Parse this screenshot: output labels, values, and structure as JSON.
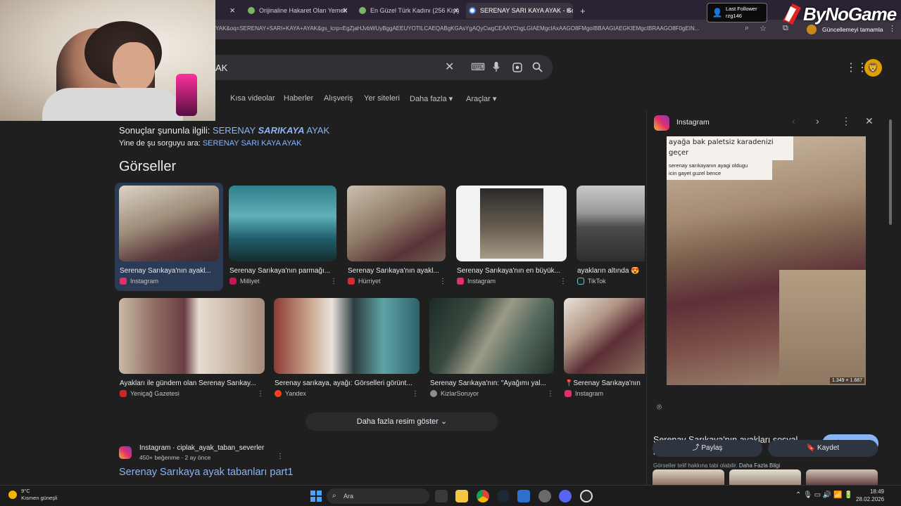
{
  "browser": {
    "tabs": [
      {
        "label": "Orijinaline Hakaret Olan Yemek",
        "color": "#7bb661"
      },
      {
        "label": "En Güzel Türk Kadını (256 Kişi)",
        "color": "#7bb661"
      },
      {
        "label": "SERENAY SARI KAYA AYAK - Go",
        "color": "#4285f4",
        "active": true
      }
    ],
    "new_tab": "+",
    "url": "YAK&oq=SERENAY+SARI+KAYA+AYAK&gs_lcrp=EgZjaHJvbWUyBggAEEUYOTILCAEQABgKGAsYgAQyCwgCEAAYChgLGIAEMgcIAxAAGO8FMgoIBBAAGIAEGKIEMgcIBRAAGO8F0gEIN...",
    "update_label": "Güncellemeyi tamamla"
  },
  "overlay": {
    "follower_title": "Last Follower",
    "follower_name": "rzg146",
    "brand": "ByNoGame"
  },
  "google": {
    "query": "AK",
    "nav": [
      "r",
      "Kısa videolar",
      "Haberler",
      "Alışveriş",
      "Yer siteleri",
      "Daha fazla ▾",
      "Araçlar ▾"
    ],
    "results_prefix": "Sonuçlar şununla ilgili: ",
    "results_term_a": "SERENAY ",
    "results_term_b": "SARIKAYA",
    "results_term_c": " AYAK",
    "search_instead_prefix": "Yine de şu sorguyu ara: ",
    "search_instead_term": "SERENAY SARI KAYA AYAK",
    "images_heading": "Görseller",
    "images_row1": [
      {
        "caption": "Serenay Sarıkaya'nın ayakl...",
        "source": "Instagram",
        "fav": "#e1306c"
      },
      {
        "caption": "Serenay Sarıkaya'nın parmağı...",
        "source": "Milliyet",
        "fav": "#c2185b"
      },
      {
        "caption": "Serenay Sarıkaya'nın ayakl...",
        "source": "Hürriyet",
        "fav": "#d32f2f"
      },
      {
        "caption": "Serenay Sarıkaya'nın en büyük...",
        "source": "Instagram",
        "fav": "#e1306c"
      },
      {
        "caption": "ayakların altında 😍",
        "source": "TikTok",
        "fav": "#222222"
      }
    ],
    "images_row2": [
      {
        "caption": "Ayakları ile gündem olan Serenay Sarıkay...",
        "source": "Yeniçağ Gazetesi",
        "fav": "#c62828"
      },
      {
        "caption": "Serenay sarıkaya, ayağı: Görselleri görünt...",
        "source": "Yandex",
        "fav": "#fc3f1d"
      },
      {
        "caption": "Serenay Sarıkaya'nın: \"Ayağımı yal...",
        "source": "KizlarSoruyor",
        "fav": "#8e8e8e"
      },
      {
        "caption": "📍Serenay Sarıkaya'nın",
        "source": "Instagram",
        "fav": "#e1306c"
      }
    ],
    "more_images": "Daha fazla resim göster",
    "result": {
      "site": "Instagram · ciplak_ayak_taban_severler",
      "meta": "450+ beğenme · 2 ay önce",
      "title": "Serenay Sarıkaya ayak tabanları part1"
    }
  },
  "panel": {
    "source": "Instagram",
    "meme_line1": "ayağa bak      paletsiz karadenizi",
    "meme_line2": "geçer",
    "meme_line3": "serenay sarıkayanın ayagi oldugu",
    "meme_line4": "icin gayet guzel bence",
    "dimensions": "1.349 × 1.687",
    "title": "Serenay Sarıkaya'nın ayakları sosyal medyada gündem oldu ...",
    "visit": "Ziyaret et ›",
    "copyright": "Görseller telif hakkına tabi olabilir.",
    "more_info": "Daha Fazla Bilgi",
    "share": "Paylaş",
    "save": "Kaydet"
  },
  "taskbar": {
    "temp": "9°C",
    "weather": "Kısmen güneşli",
    "search": "Ara",
    "time": "18:49",
    "date": "28.02.2026"
  }
}
